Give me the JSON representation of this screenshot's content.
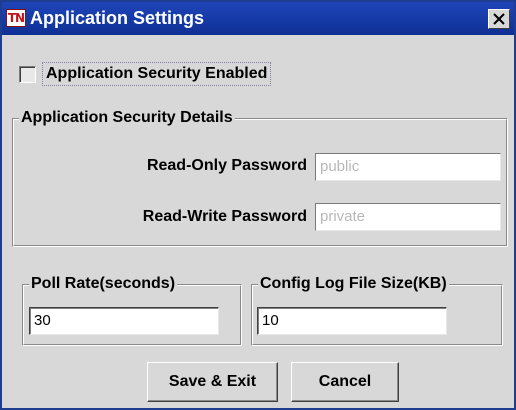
{
  "window": {
    "title": "Application Settings",
    "app_icon": "tn-logo-icon",
    "close_icon": "close-icon",
    "app_icon_text": "TN"
  },
  "security": {
    "checkbox_label": "Application Security Enabled",
    "checkbox_checked": false
  },
  "details": {
    "group_title": "Application Security Details",
    "read_only_label": "Read-Only Password",
    "read_only_value": "public",
    "read_write_label": "Read-Write Password",
    "read_write_value": "private"
  },
  "poll": {
    "group_title": "Poll Rate(seconds)",
    "value": "30"
  },
  "log": {
    "group_title": "Config Log File Size(KB)",
    "value": "10"
  },
  "buttons": {
    "save_label": "Save & Exit",
    "cancel_label": "Cancel"
  },
  "colors": {
    "titlebar": "#153aa6",
    "window_bg": "#d8d8d8",
    "disabled_text": "#b8b8b8"
  }
}
